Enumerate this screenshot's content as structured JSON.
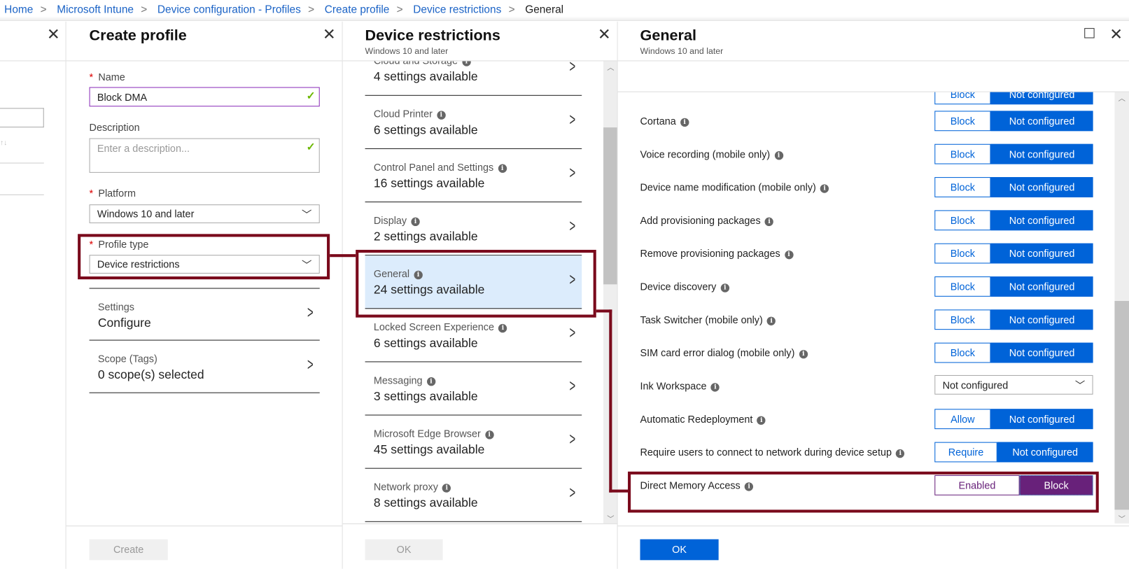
{
  "breadcrumb": [
    "Home",
    "Microsoft Intune",
    "Device configuration - Profiles",
    "Create profile",
    "Device restrictions",
    "General"
  ],
  "create_profile": {
    "title": "Create profile",
    "name_label": "Name",
    "name_value": "Block DMA",
    "description_label": "Description",
    "description_placeholder": "Enter a description...",
    "platform_label": "Platform",
    "platform_value": "Windows 10 and later",
    "profile_type_label": "Profile type",
    "profile_type_value": "Device restrictions",
    "settings_label": "Settings",
    "settings_value": "Configure",
    "scope_label": "Scope (Tags)",
    "scope_value": "0 scope(s) selected",
    "create_button": "Create"
  },
  "device_restrictions": {
    "title": "Device restrictions",
    "subtitle": "Windows 10 and later",
    "ok_button": "OK",
    "items": [
      {
        "name": "Cloud and Storage",
        "count": "4 settings available"
      },
      {
        "name": "Cloud Printer",
        "count": "6 settings available"
      },
      {
        "name": "Control Panel and Settings",
        "count": "16 settings available"
      },
      {
        "name": "Display",
        "count": "2 settings available"
      },
      {
        "name": "General",
        "count": "24 settings available",
        "selected": true
      },
      {
        "name": "Locked Screen Experience",
        "count": "6 settings available"
      },
      {
        "name": "Messaging",
        "count": "3 settings available"
      },
      {
        "name": "Microsoft Edge Browser",
        "count": "45 settings available"
      },
      {
        "name": "Network proxy",
        "count": "8 settings available"
      }
    ]
  },
  "general": {
    "title": "General",
    "subtitle": "Windows 10 and later",
    "ok_button": "OK",
    "partial_toggle": [
      "Block",
      "Not configured"
    ],
    "settings": [
      {
        "label": "Cortana",
        "type": "toggle",
        "options": [
          "Block",
          "Not configured"
        ],
        "selected": 1
      },
      {
        "label": "Voice recording (mobile only)",
        "type": "toggle",
        "options": [
          "Block",
          "Not configured"
        ],
        "selected": 1
      },
      {
        "label": "Device name modification (mobile only)",
        "type": "toggle",
        "options": [
          "Block",
          "Not configured"
        ],
        "selected": 1
      },
      {
        "label": "Add provisioning packages",
        "type": "toggle",
        "options": [
          "Block",
          "Not configured"
        ],
        "selected": 1
      },
      {
        "label": "Remove provisioning packages",
        "type": "toggle",
        "options": [
          "Block",
          "Not configured"
        ],
        "selected": 1
      },
      {
        "label": "Device discovery",
        "type": "toggle",
        "options": [
          "Block",
          "Not configured"
        ],
        "selected": 1
      },
      {
        "label": "Task Switcher (mobile only)",
        "type": "toggle",
        "options": [
          "Block",
          "Not configured"
        ],
        "selected": 1
      },
      {
        "label": "SIM card error dialog (mobile only)",
        "type": "toggle",
        "options": [
          "Block",
          "Not configured"
        ],
        "selected": 1
      },
      {
        "label": "Ink Workspace",
        "type": "select",
        "value": "Not configured"
      },
      {
        "label": "Automatic Redeployment",
        "type": "toggle",
        "options": [
          "Allow",
          "Not configured"
        ],
        "selected": 1
      },
      {
        "label": "Require users to connect to network during device setup",
        "type": "toggle",
        "options": [
          "Require",
          "Not configured"
        ],
        "selected": 1
      },
      {
        "label": "Direct Memory Access",
        "type": "toggle",
        "options": [
          "Enabled",
          "Block"
        ],
        "selected": 1,
        "highlight": true
      }
    ]
  },
  "colors": {
    "accent": "#0063d8",
    "selected_purple": "#68217a",
    "highlight_box": "#7a0a1c",
    "selected_row": "#dcecfc"
  }
}
